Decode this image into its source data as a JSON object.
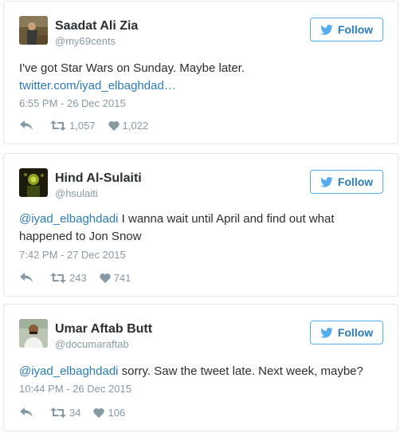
{
  "tweets": [
    {
      "author_name": "Saadat Ali Zia",
      "author_handle": "@my69cents",
      "follow_label": "Follow",
      "text": "I've got Star Wars on Sunday. Maybe later.",
      "link": "twitter.com/iyad_elbaghdad…",
      "timestamp": "6:55 PM - 26 Dec 2015",
      "retweets": "1,057",
      "likes": "1,022"
    },
    {
      "author_name": "Hind Al-Sulaiti",
      "author_handle": "@hsulaiti",
      "follow_label": "Follow",
      "mention": "@iyad_elbaghdadi",
      "text": " I wanna wait until April and find out what happened to Jon Snow",
      "timestamp": "7:42 PM - 27 Dec 2015",
      "retweets": "243",
      "likes": "741"
    },
    {
      "author_name": "Umar Aftab Butt",
      "author_handle": "@documaraftab",
      "follow_label": "Follow",
      "mention": "@iyad_elbaghdadi",
      "text": " sorry. Saw the tweet late. Next week, maybe?",
      "timestamp": "10:44 PM - 26 Dec 2015",
      "retweets": "34",
      "likes": "106"
    }
  ],
  "icons": {
    "follow": "twitter-bird-icon",
    "reply": "reply-icon",
    "retweet": "retweet-icon",
    "like": "heart-icon"
  },
  "colors": {
    "accent": "#55acee",
    "link": "#2b7bb9",
    "muted": "#8899a6",
    "text": "#292f33",
    "border": "#e1e8ed"
  }
}
